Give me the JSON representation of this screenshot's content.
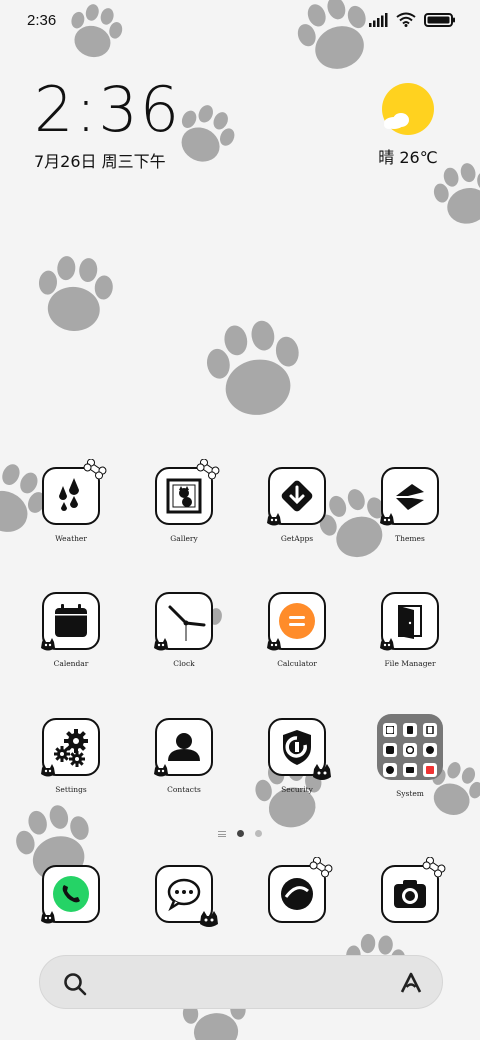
{
  "status_bar": {
    "time": "2:36",
    "icons": [
      "signal-icon",
      "wifi-icon",
      "battery-icon"
    ]
  },
  "clock_widget": {
    "time": "2:36",
    "date": "7月26日 周三下午"
  },
  "weather_widget": {
    "icon": "sun-cloud-icon",
    "text": "晴 26℃"
  },
  "apps": [
    {
      "label": "Weather",
      "icon": "weather-icon"
    },
    {
      "label": "Gallery",
      "icon": "gallery-icon"
    },
    {
      "label": "GetApps",
      "icon": "getapps-icon"
    },
    {
      "label": "Themes",
      "icon": "themes-icon"
    },
    {
      "label": "Calendar",
      "icon": "calendar-icon"
    },
    {
      "label": "Clock",
      "icon": "clock-icon"
    },
    {
      "label": "Calculator",
      "icon": "calculator-icon"
    },
    {
      "label": "File Manager",
      "icon": "file-manager-icon"
    },
    {
      "label": "Settings",
      "icon": "settings-icon"
    },
    {
      "label": "Contacts",
      "icon": "contacts-icon"
    },
    {
      "label": "Security",
      "icon": "security-icon"
    },
    {
      "label": "System",
      "icon": "system-folder-icon"
    }
  ],
  "dock": [
    {
      "icon": "phone-icon"
    },
    {
      "icon": "messages-icon"
    },
    {
      "icon": "browser-icon"
    },
    {
      "icon": "camera-icon"
    }
  ],
  "page_indicator": {
    "pages": 2,
    "active": 1
  },
  "search": {
    "placeholder": ""
  },
  "colors": {
    "background": "#f4f4f4",
    "paw": "#a8a8a8",
    "sun": "#ffd21f",
    "phone_green": "#25d366",
    "calculator_orange": "#ff8c2a"
  }
}
